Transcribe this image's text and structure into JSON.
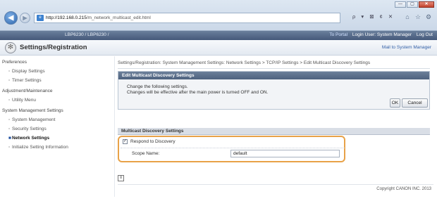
{
  "browser": {
    "url_host": "http://192.168.0.215",
    "url_path": "/m_network_multicast_edit.html",
    "addr_icons": "ρ ▾ ⊠ ¢ ✕",
    "window_controls": [
      "—",
      "▢",
      "✕"
    ]
  },
  "titlebar": {
    "model": "LBP6230 / LBP6230 /",
    "portal_link": "To Portal",
    "login_user": "Login User: System Manager",
    "logout": "Log Out"
  },
  "header": {
    "title": "Settings/Registration",
    "mail_link": "Mail to System Manager"
  },
  "sidebar": {
    "items": [
      {
        "type": "head",
        "label": "Preferences"
      },
      {
        "type": "sub",
        "label": "Display Settings"
      },
      {
        "type": "sub",
        "label": "Timer Settings"
      },
      {
        "type": "head",
        "label": "Adjustment/Maintenance"
      },
      {
        "type": "sub",
        "label": "Utility Menu"
      },
      {
        "type": "head",
        "label": "System Management Settings"
      },
      {
        "type": "sub",
        "label": "System Management"
      },
      {
        "type": "sub",
        "label": "Security Settings"
      },
      {
        "type": "sub",
        "label": "Network Settings",
        "active": true
      },
      {
        "type": "sub",
        "label": "Initialize Setting Information"
      }
    ]
  },
  "content": {
    "breadcrumb": "Settings/Registration: System Management Settings: Network Settings > TCP/IP Settings > Edit Multicast Discovery Settings",
    "edit_panel_title": "Edit Multicast Discovery Settings",
    "message_line1": "Change the following settings.",
    "message_line2": "Changes will be effective after the main power is turned OFF and ON.",
    "ok_label": "OK",
    "cancel_label": "Cancel",
    "section_title": "Multicast Discovery Settings",
    "respond_label": "Respond to Discovery",
    "respond_checked": true,
    "scope_name_label": "Scope Name:",
    "scope_name_value": "default",
    "back_icon_glyph": "≡"
  },
  "footer": {
    "copyright": "Copyright CANON INC. 2013"
  },
  "colors": {
    "highlight_border": "#e8a248",
    "titlebar_bg": "#45597a",
    "panel_title_bg": "#4e627f"
  },
  "icons": [
    "back-arrow-icon",
    "forward-arrow-icon",
    "site-favicon-icon",
    "home-icon",
    "favorites-star-icon",
    "settings-gear-icon",
    "settings-registration-icon",
    "checkbox-checked-icon",
    "return-icon"
  ]
}
